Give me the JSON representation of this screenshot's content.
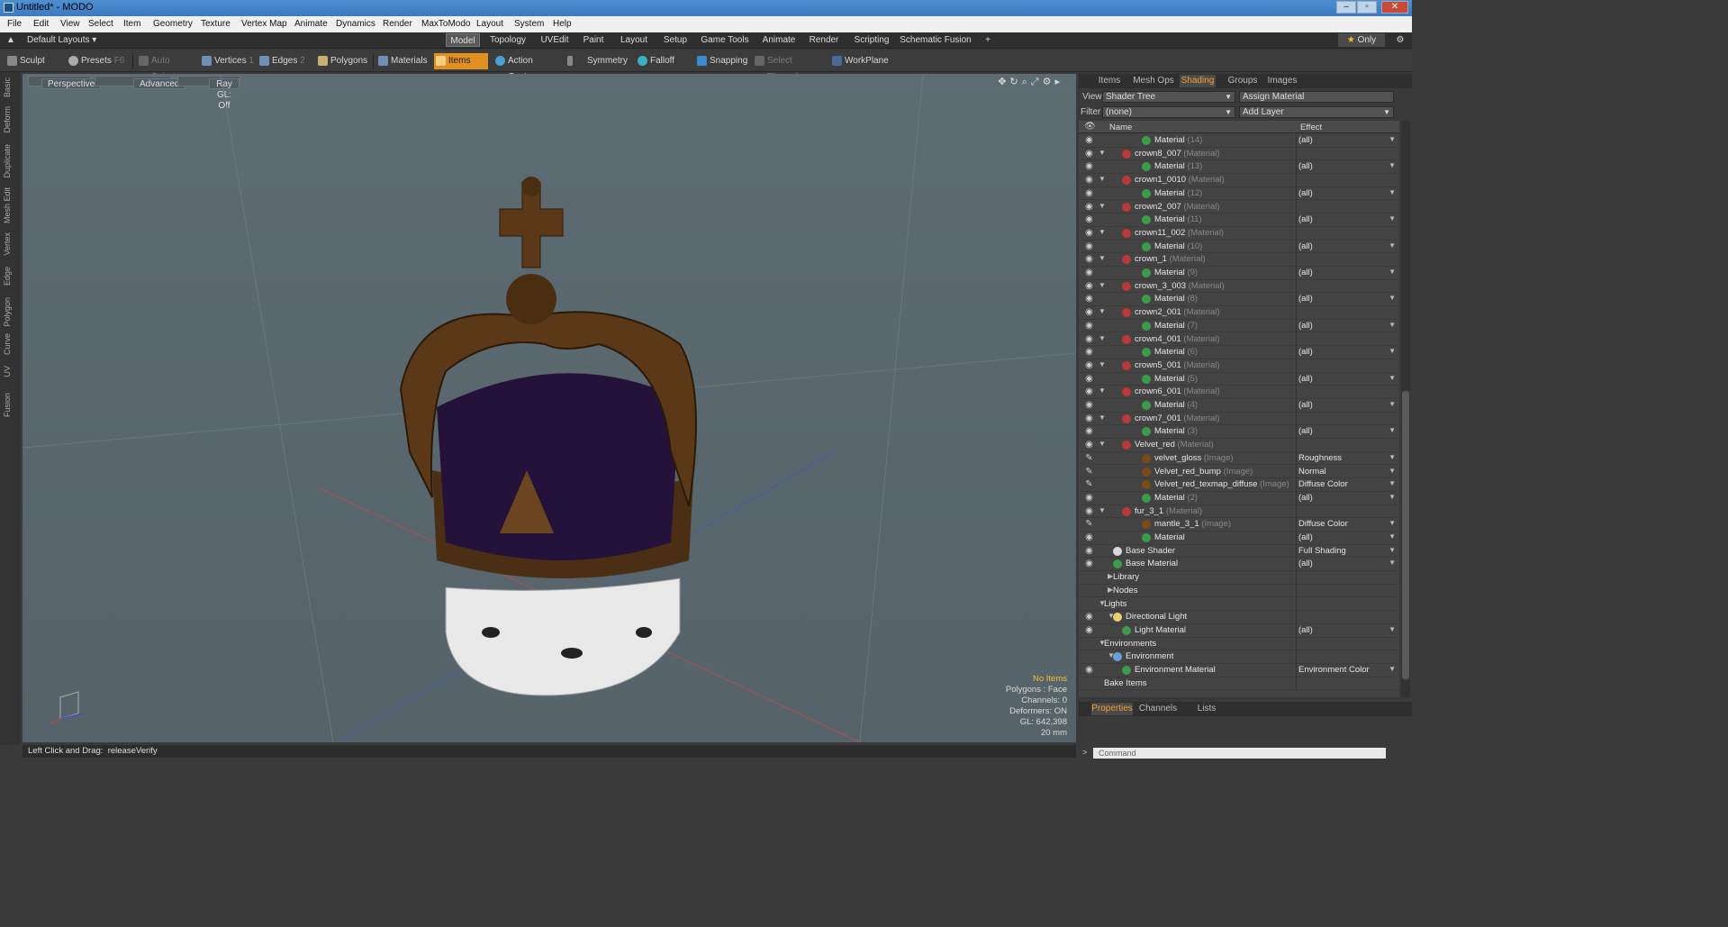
{
  "window": {
    "title": "Untitled* - MODO"
  },
  "menu": [
    "File",
    "Edit",
    "View",
    "Select",
    "Item",
    "Geometry",
    "Texture",
    "Vertex Map",
    "Animate",
    "Dynamics",
    "Render",
    "MaxToModo",
    "Layout",
    "System",
    "Help"
  ],
  "layout_selector": "Default Layouts",
  "mode_tabs": [
    "Model",
    "Topology",
    "UVEdit",
    "Paint",
    "Layout",
    "Setup",
    "Game Tools",
    "Animate",
    "Render",
    "Scripting",
    "Schematic Fusion"
  ],
  "only_label": "Only",
  "tools": {
    "sculpt": "Sculpt",
    "presets": "Presets",
    "presets_key": "F6",
    "auto_select": "Auto Select",
    "vertices": "Vertices",
    "vertices_n": "1",
    "edges": "Edges",
    "edges_n": "2",
    "polygons": "Polygons",
    "materials": "Materials",
    "items": "Items",
    "action_center": "Action Center",
    "symmetry": "Symmetry",
    "falloff": "Falloff",
    "snapping": "Snapping",
    "select_through": "Select Through",
    "workplane": "WorkPlane"
  },
  "side_tabs": [
    "Basic",
    "Deform",
    "Duplicate",
    "Mesh Edit",
    "Vertex",
    "Edge",
    "Polygon",
    "Curve",
    "UV",
    "Fusion"
  ],
  "viewport": {
    "projection": "Perspective",
    "advanced": "Advanced",
    "raygl": "Ray GL: Off",
    "info": {
      "no_items": "No Items",
      "polygons": "Polygons : Face",
      "channels": "Channels: 0",
      "deformers": "Deformers: ON",
      "gl": "GL: 642,398",
      "scale": "20 mm"
    }
  },
  "status": {
    "hint": "Left Click and Drag:",
    "action": "releaseVerify"
  },
  "panel": {
    "tabs": [
      "Items",
      "Mesh Ops",
      "Shading",
      "Groups",
      "Images"
    ],
    "active_tab": "Shading",
    "view_label": "View",
    "view_value": "Shader Tree",
    "assign": "Assign Material",
    "filter_label": "Filter",
    "filter_value": "(none)",
    "add_layer": "Add Layer",
    "col_name": "Name",
    "col_effect": "Effect",
    "rows": [
      {
        "n": "Material",
        "t": "(14)",
        "e": "(all)",
        "d": 3,
        "c": "#3d9a4a"
      },
      {
        "n": "crown8_007",
        "t": "(Material)",
        "e": "",
        "d": 2,
        "c": "#b83a3a",
        "x": 1
      },
      {
        "n": "Material",
        "t": "(13)",
        "e": "(all)",
        "d": 3,
        "c": "#3d9a4a"
      },
      {
        "n": "crown1_0010",
        "t": "(Material)",
        "e": "",
        "d": 2,
        "c": "#b83a3a",
        "x": 1
      },
      {
        "n": "Material",
        "t": "(12)",
        "e": "(all)",
        "d": 3,
        "c": "#3d9a4a"
      },
      {
        "n": "crown2_007",
        "t": "(Material)",
        "e": "",
        "d": 2,
        "c": "#b83a3a",
        "x": 1
      },
      {
        "n": "Material",
        "t": "(11)",
        "e": "(all)",
        "d": 3,
        "c": "#3d9a4a"
      },
      {
        "n": "crown11_002",
        "t": "(Material)",
        "e": "",
        "d": 2,
        "c": "#b83a3a",
        "x": 1
      },
      {
        "n": "Material",
        "t": "(10)",
        "e": "(all)",
        "d": 3,
        "c": "#3d9a4a"
      },
      {
        "n": "crown_1",
        "t": "(Material)",
        "e": "",
        "d": 2,
        "c": "#b83a3a",
        "x": 1
      },
      {
        "n": "Material",
        "t": "(9)",
        "e": "(all)",
        "d": 3,
        "c": "#3d9a4a"
      },
      {
        "n": "crown_3_003",
        "t": "(Material)",
        "e": "",
        "d": 2,
        "c": "#b83a3a",
        "x": 1
      },
      {
        "n": "Material",
        "t": "(8)",
        "e": "(all)",
        "d": 3,
        "c": "#3d9a4a"
      },
      {
        "n": "crown2_001",
        "t": "(Material)",
        "e": "",
        "d": 2,
        "c": "#b83a3a",
        "x": 1
      },
      {
        "n": "Material",
        "t": "(7)",
        "e": "(all)",
        "d": 3,
        "c": "#3d9a4a"
      },
      {
        "n": "crown4_001",
        "t": "(Material)",
        "e": "",
        "d": 2,
        "c": "#b83a3a",
        "x": 1
      },
      {
        "n": "Material",
        "t": "(6)",
        "e": "(all)",
        "d": 3,
        "c": "#3d9a4a"
      },
      {
        "n": "crown5_001",
        "t": "(Material)",
        "e": "",
        "d": 2,
        "c": "#b83a3a",
        "x": 1
      },
      {
        "n": "Material",
        "t": "(5)",
        "e": "(all)",
        "d": 3,
        "c": "#3d9a4a"
      },
      {
        "n": "crown6_001",
        "t": "(Material)",
        "e": "",
        "d": 2,
        "c": "#b83a3a",
        "x": 1
      },
      {
        "n": "Material",
        "t": "(4)",
        "e": "(all)",
        "d": 3,
        "c": "#3d9a4a"
      },
      {
        "n": "crown7_001",
        "t": "(Material)",
        "e": "",
        "d": 2,
        "c": "#b83a3a",
        "x": 1
      },
      {
        "n": "Material",
        "t": "(3)",
        "e": "(all)",
        "d": 3,
        "c": "#3d9a4a"
      },
      {
        "n": "Velvet_red",
        "t": "(Material)",
        "e": "",
        "d": 2,
        "c": "#b83a3a",
        "x": 1
      },
      {
        "n": "velvet_gloss",
        "t": "(Image)",
        "e": "Roughness",
        "d": 3,
        "c": "#7a4a18",
        "p": 1
      },
      {
        "n": "Velvet_red_bump",
        "t": "(Image)",
        "e": "Normal",
        "d": 3,
        "c": "#7a4a18",
        "p": 1
      },
      {
        "n": "Velvet_red_texmap_diffuse",
        "t": "(Image)",
        "e": "Diffuse Color",
        "d": 3,
        "c": "#7a4a18",
        "p": 1
      },
      {
        "n": "Material",
        "t": "(2)",
        "e": "(all)",
        "d": 3,
        "c": "#3d9a4a"
      },
      {
        "n": "fur_3_1",
        "t": "(Material)",
        "e": "",
        "d": 2,
        "c": "#b83a3a",
        "x": 1
      },
      {
        "n": "mantle_3_1",
        "t": "(Image)",
        "e": "Diffuse Color",
        "d": 3,
        "c": "#7a4a18",
        "p": 1
      },
      {
        "n": "Material",
        "t": "",
        "e": "(all)",
        "d": 3,
        "c": "#3d9a4a"
      },
      {
        "n": "Base Shader",
        "t": "",
        "e": "Full Shading",
        "d": 1,
        "c": "#d8d8d8"
      },
      {
        "n": "Base Material",
        "t": "",
        "e": "(all)",
        "d": 1,
        "c": "#3d9a4a"
      },
      {
        "n": "Library",
        "t": "",
        "e": "",
        "d": 1,
        "f": 1,
        "ne": 1
      },
      {
        "n": "Nodes",
        "t": "",
        "e": "",
        "d": 1,
        "f": 1,
        "ne": 1
      },
      {
        "n": "Lights",
        "t": "",
        "e": "",
        "d": 0,
        "x": 1,
        "ne": 1
      },
      {
        "n": "Directional Light",
        "t": "",
        "e": "",
        "d": 1,
        "c": "#e8d070",
        "x": 1
      },
      {
        "n": "Light Material",
        "t": "",
        "e": "(all)",
        "d": 2,
        "c": "#3d9a4a"
      },
      {
        "n": "Environments",
        "t": "",
        "e": "",
        "d": 0,
        "x": 1,
        "ne": 1
      },
      {
        "n": "Environment",
        "t": "",
        "e": "",
        "d": 1,
        "c": "#6aa0d8",
        "x": 1,
        "ne": 1
      },
      {
        "n": "Environment Material",
        "t": "",
        "e": "Environment Color",
        "d": 2,
        "c": "#3d9a4a"
      },
      {
        "n": "Bake Items",
        "t": "",
        "e": "",
        "d": 0,
        "ne": 1
      }
    ],
    "bottom_tabs": [
      "Properties",
      "Channels",
      "Lists"
    ],
    "active_bottom": "Properties",
    "command_placeholder": "Command"
  }
}
